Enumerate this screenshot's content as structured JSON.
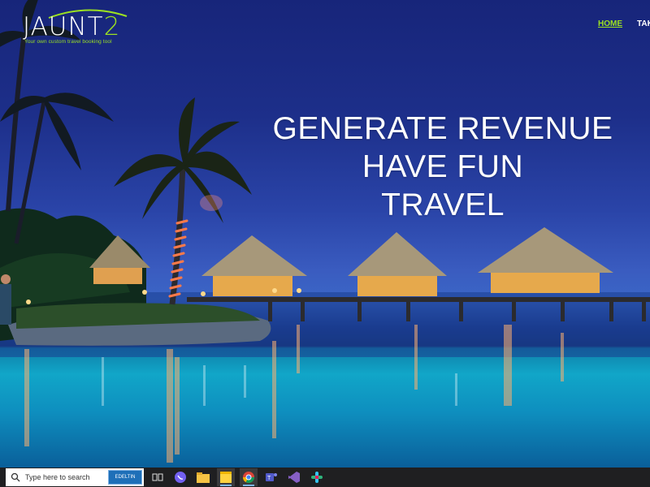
{
  "brand": {
    "name_main": "JAUNT",
    "name_accent": "2",
    "tagline": "Your own custom travel booking tool"
  },
  "nav": {
    "items": [
      {
        "label": "HOME",
        "active": true
      },
      {
        "label": "TAKE"
      }
    ]
  },
  "hero": {
    "lines": [
      "GENERATE REVENUE",
      "HAVE FUN",
      "TRAVEL"
    ]
  },
  "taskbar": {
    "search_placeholder": "Type here to search",
    "widget_label": "EDELTIN",
    "apps": [
      "task-view",
      "viber",
      "file-explorer",
      "sticky-notes",
      "chrome",
      "teams",
      "visual-studio",
      "slack"
    ]
  },
  "colors": {
    "accent_green": "#9be022",
    "sky": "#1d2f8a",
    "pool": "#11a6c8",
    "taskbar": "#1f1f21"
  }
}
